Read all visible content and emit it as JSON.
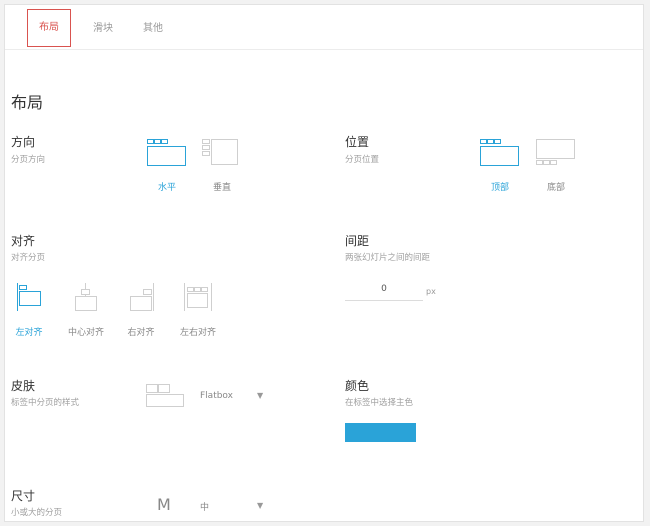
{
  "tabs": [
    {
      "label": "布局",
      "active": true
    },
    {
      "label": "滑块",
      "active": false
    },
    {
      "label": "其他",
      "active": false
    }
  ],
  "section_title": "布局",
  "direction": {
    "title": "方向",
    "subtitle": "分页方向",
    "options": [
      {
        "label": "水平",
        "selected": true
      },
      {
        "label": "垂直",
        "selected": false
      }
    ]
  },
  "position": {
    "title": "位置",
    "subtitle": "分页位置",
    "options": [
      {
        "label": "顶部",
        "selected": true
      },
      {
        "label": "底部",
        "selected": false
      }
    ]
  },
  "align": {
    "title": "对齐",
    "subtitle": "对齐分页",
    "options": [
      {
        "label": "左对齐",
        "selected": true
      },
      {
        "label": "中心对齐",
        "selected": false
      },
      {
        "label": "右对齐",
        "selected": false
      },
      {
        "label": "左右对齐",
        "selected": false
      }
    ]
  },
  "spacing": {
    "title": "间距",
    "subtitle": "两张幻灯片之间的间距",
    "value": "0",
    "unit": "px"
  },
  "skin": {
    "title": "皮肤",
    "subtitle": "标签中分页的样式",
    "value": "Flatbox"
  },
  "color": {
    "title": "颜色",
    "subtitle": "在标签中选择主色",
    "value": "#2aa3d8"
  },
  "size": {
    "title": "尺寸",
    "subtitle": "小或大的分页",
    "glyph": "M",
    "value": "中"
  },
  "colors": {
    "accent": "#2aa3d8",
    "active_tab": "#d9534f"
  }
}
